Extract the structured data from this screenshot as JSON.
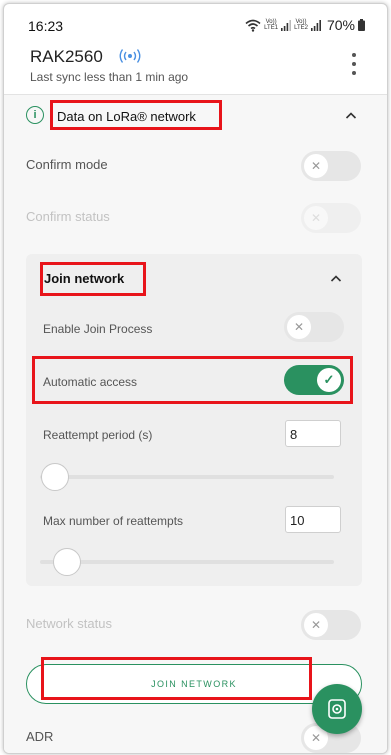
{
  "status_bar": {
    "time": "16:23",
    "sim1_label_top": "Vo))",
    "sim1_label_bottom": "LTE1",
    "sim2_label_top": "Vo))",
    "sim2_label_bottom": "LTE2",
    "battery": "70%",
    "icons": [
      "wifi-icon",
      "signal-icon",
      "battery-icon"
    ]
  },
  "header": {
    "device_name": "RAK2560",
    "last_sync": "Last sync less than 1 min ago",
    "icons": [
      "broadcast-icon",
      "kebab-menu-icon"
    ]
  },
  "section": {
    "title": "Data on LoRa® network",
    "icons": [
      "info-icon",
      "chevron-up-icon"
    ],
    "confirm_mode_label": "Confirm mode",
    "confirm_mode_on": false,
    "confirm_status_label": "Confirm status",
    "confirm_status_on": false
  },
  "join_card": {
    "title": "Join network",
    "enable_join_label": "Enable Join Process",
    "enable_join_on": false,
    "automatic_access_label": "Automatic access",
    "automatic_access_on": true,
    "reattempt_label": "Reattempt period (s)",
    "reattempt_value": "8",
    "reattempt_slider_level": 0,
    "max_reattempts_label": "Max number of reattempts",
    "max_reattempts_value": "10",
    "max_reattempts_slider_level": 0
  },
  "network_status": {
    "label": "Network status",
    "on": false
  },
  "join_button_label": "JOIN NETWORK",
  "adr": {
    "label": "ADR",
    "on": false
  },
  "colors": {
    "accent": "#2a9160",
    "highlight": "#e8141a"
  }
}
